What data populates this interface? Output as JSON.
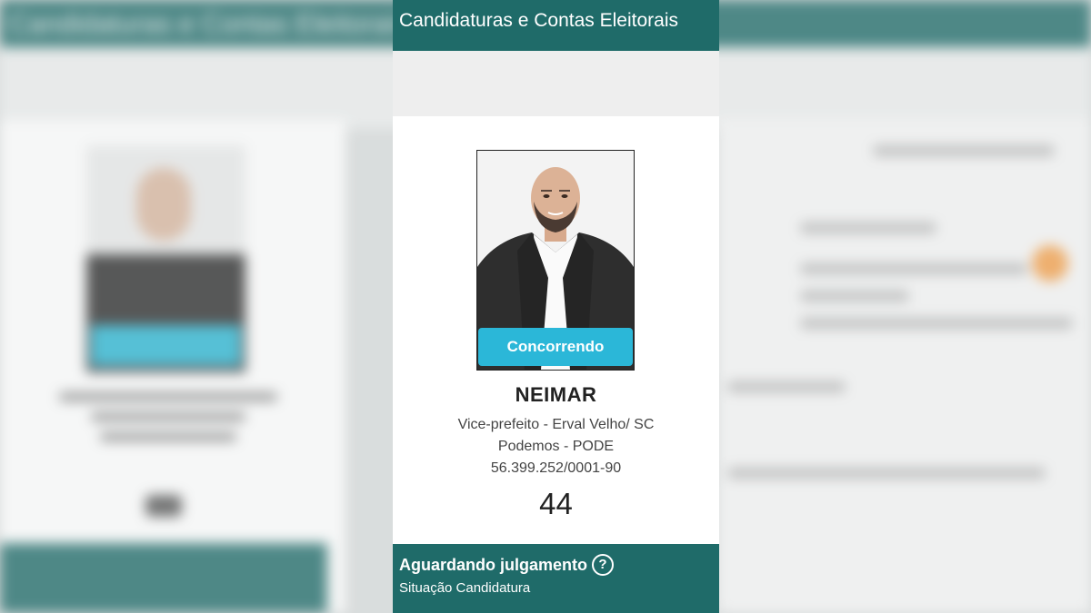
{
  "header": {
    "title": "Candidaturas e Contas Eleitorais"
  },
  "candidate": {
    "status_badge": "Concorrendo",
    "name": "NEIMAR",
    "role_location": "Vice-prefeito - Erval Velho/ SC",
    "party": "Podemos - PODE",
    "cnpj": "56.399.252/0001-90",
    "number": "44"
  },
  "situation": {
    "title": "Aguardando julgamento",
    "help_icon": "question-circle-icon",
    "subtitle": "Situação Candidatura"
  },
  "colors": {
    "header_bg": "#1f6b69",
    "badge_bg": "#2bb7d8",
    "situation_bg": "#1f6b69"
  }
}
